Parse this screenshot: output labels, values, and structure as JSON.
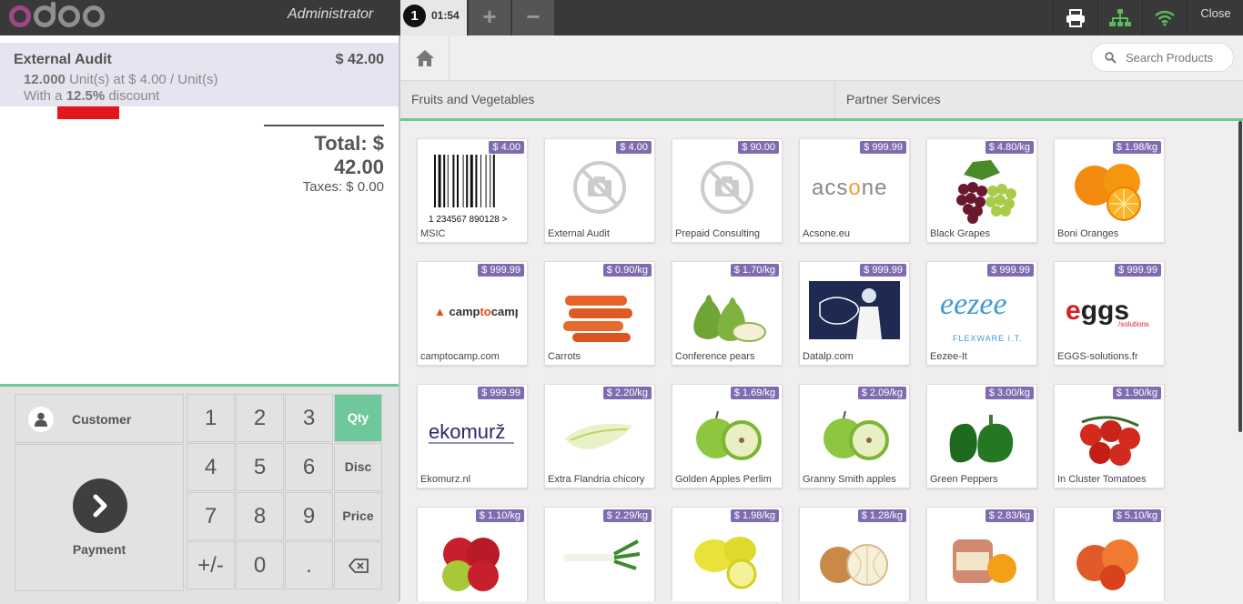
{
  "header": {
    "logo_text": "odoo",
    "user_name": "Administrator",
    "order_number": "1",
    "order_time": "01:54",
    "add_order_label": "+",
    "remove_order_label": "−",
    "print_icon": "printer-icon",
    "network_icon": "network-icon",
    "wifi_icon": "wifi-icon",
    "close_label": "Close",
    "wifi_color": "#5cb85c",
    "network_color": "#5cb85c"
  },
  "order": {
    "line": {
      "name": "External Audit",
      "price": "$ 42.00",
      "qty": "12.000",
      "unit_text": "Unit(s) at $ 4.00 / Unit(s)",
      "discount_prefix": "With a",
      "discount_value": "12.5%",
      "discount_suffix": "discount"
    },
    "total": "Total: $ 42.00",
    "taxes": "Taxes: $ 0.00"
  },
  "numpad": {
    "customer_label": "Customer",
    "payment_label": "Payment",
    "keys": [
      "1",
      "2",
      "3",
      "Qty",
      "4",
      "5",
      "6",
      "Disc",
      "7",
      "8",
      "9",
      "Price",
      "+/-",
      "0",
      ".",
      "⌫"
    ],
    "active_mode": "Qty"
  },
  "products_screen": {
    "search_placeholder": "Search Products",
    "categories": [
      "Fruits and Vegetables",
      "Partner Services"
    ],
    "items": [
      {
        "name": "MSIC",
        "price": "$ 4.00",
        "img": "barcode"
      },
      {
        "name": "External Audit",
        "price": "$ 4.00",
        "img": "no-image"
      },
      {
        "name": "Prepaid Consulting",
        "price": "$ 90.00",
        "img": "no-image"
      },
      {
        "name": "Acsone.eu",
        "price": "$ 999.99",
        "img": "acsone-logo"
      },
      {
        "name": "Black Grapes",
        "price": "$ 4.80/kg",
        "img": "grapes"
      },
      {
        "name": "Boni Oranges",
        "price": "$ 1.98/kg",
        "img": "oranges"
      },
      {
        "name": "camptocamp.com",
        "price": "$ 999.99",
        "img": "camptocamp-logo"
      },
      {
        "name": "Carrots",
        "price": "$ 0.90/kg",
        "img": "carrots"
      },
      {
        "name": "Conference pears",
        "price": "$ 1.70/kg",
        "img": "pears"
      },
      {
        "name": "Datalp.com",
        "price": "$ 999.99",
        "img": "datalp-logo"
      },
      {
        "name": "Eezee-It",
        "price": "$ 999.99",
        "img": "eezee-logo"
      },
      {
        "name": "EGGS-solutions.fr",
        "price": "$ 999.99",
        "img": "eggs-logo"
      },
      {
        "name": "Ekomurz.nl",
        "price": "$ 999.99",
        "img": "ekomurz-logo"
      },
      {
        "name": "Extra Flandria chicory",
        "price": "$ 2.20/kg",
        "img": "chicory"
      },
      {
        "name": "Golden Apples Perlim",
        "price": "$ 1.69/kg",
        "img": "green-apples"
      },
      {
        "name": "Granny Smith apples",
        "price": "$ 2.09/kg",
        "img": "green-apples"
      },
      {
        "name": "Green Peppers",
        "price": "$ 3.00/kg",
        "img": "peppers"
      },
      {
        "name": "In Cluster Tomatoes",
        "price": "$ 1.90/kg",
        "img": "tomatoes"
      },
      {
        "name": "",
        "price": "$ 1.10/kg",
        "img": "apples"
      },
      {
        "name": "",
        "price": "$ 2.29/kg",
        "img": "leeks"
      },
      {
        "name": "",
        "price": "$ 1.98/kg",
        "img": "lemons"
      },
      {
        "name": "",
        "price": "$ 1.28/kg",
        "img": "onions"
      },
      {
        "name": "",
        "price": "$ 2.83/kg",
        "img": "orange-jar"
      },
      {
        "name": "",
        "price": "$ 5.10/kg",
        "img": "peaches"
      }
    ]
  },
  "colors": {
    "accent_green": "#6ec89b",
    "price_tag": "#7f6baf",
    "orderline_bg": "#e6e4f0",
    "discount_marker": "#e3161c"
  }
}
